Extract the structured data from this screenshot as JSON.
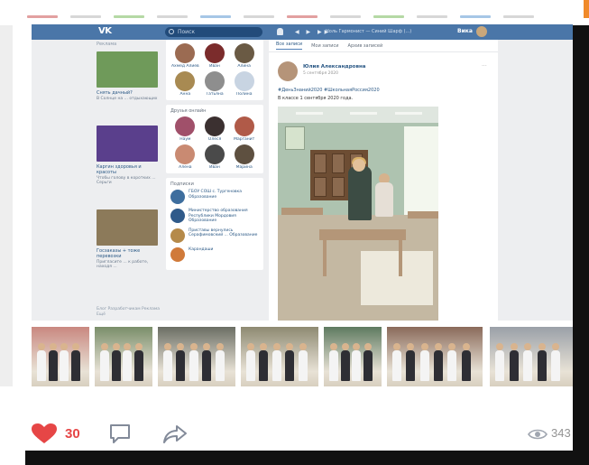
{
  "header": {
    "logo": "VK",
    "search_placeholder": "Поиск",
    "player_controls": "◀ ▶ ▶▶",
    "now_playing": "Ноль Гармонист — Синий Шарф (...)",
    "user_name": "Вика"
  },
  "ads": {
    "heading": "Реклама",
    "items": [
      {
        "title": "Снять дачный?",
        "subtitle": "В Солнце на ... отдыхающих",
        "color": "#6f9a5a"
      },
      {
        "title": "Каргин здоровья и красоты",
        "subtitle": "Чтобы голову в коротких ... Серьги",
        "color": "#5a3f8c"
      },
      {
        "title": "Госзаказы + тоже перевозки",
        "subtitle": "Пригласите ... к работе, находя ...",
        "color": "#8c7a5a"
      }
    ],
    "footer": "Блог  Разработчикам  Реклама  Ещё"
  },
  "friends_card": {
    "labels": [
      "Ахмед Алиев",
      "Иван",
      "Алина",
      "Анна",
      "Татьяна",
      "Полина"
    ],
    "colors": [
      "#9b6b52",
      "#7b2c2c",
      "#6a5a44",
      "#a88a52",
      "#8e8e8e",
      "#c8d4e2"
    ]
  },
  "friends_online": {
    "title": "Друзья онлайн",
    "labels": [
      "Наум",
      "Олеся",
      "Марганит",
      "Алёна",
      "Иван",
      "Марина"
    ],
    "colors": [
      "#a0506a",
      "#3b3030",
      "#b05a48",
      "#c98a72",
      "#4a4a4a",
      "#5e5040"
    ]
  },
  "subscriptions": {
    "title": "Подписки",
    "items": [
      {
        "text": "ГБОУ СОШ с. Тургеновка Образование",
        "color": "#3e6e9e"
      },
      {
        "text": "Министерство образования Республики Мордовия Образование",
        "color": "#2f5a8a"
      },
      {
        "text": "Приставы вернулись Серафимовский ... Образование",
        "color": "#b58a4a"
      },
      {
        "text": "Карандаши",
        "color": "#d07a3a"
      }
    ]
  },
  "feed": {
    "tabs": [
      "Все записи",
      "Мои записи",
      "Архив записей"
    ],
    "author": "Юлия Александровна",
    "date": "5 сентября 2020",
    "tags": "#ДеньЗнаний2020 #ШкольнаяРоссия2020",
    "text": "В классе 1 сентября 2020 года.",
    "menu": "···"
  },
  "thumbnails": [
    {
      "bg": "#c98880"
    },
    {
      "bg": "#7a8e6a"
    },
    {
      "bg": "#6b6e64"
    },
    {
      "bg": "#8e8a72"
    },
    {
      "bg": "#5e7a60"
    },
    {
      "bg": "#8a6a5a"
    },
    {
      "bg": "#9aa0a8"
    }
  ],
  "actions": {
    "like_count": "30",
    "views_count": "343"
  },
  "colors": {
    "header_blue": "#4a76a8",
    "like_red": "#e64646",
    "link_blue": "#2a5885"
  }
}
